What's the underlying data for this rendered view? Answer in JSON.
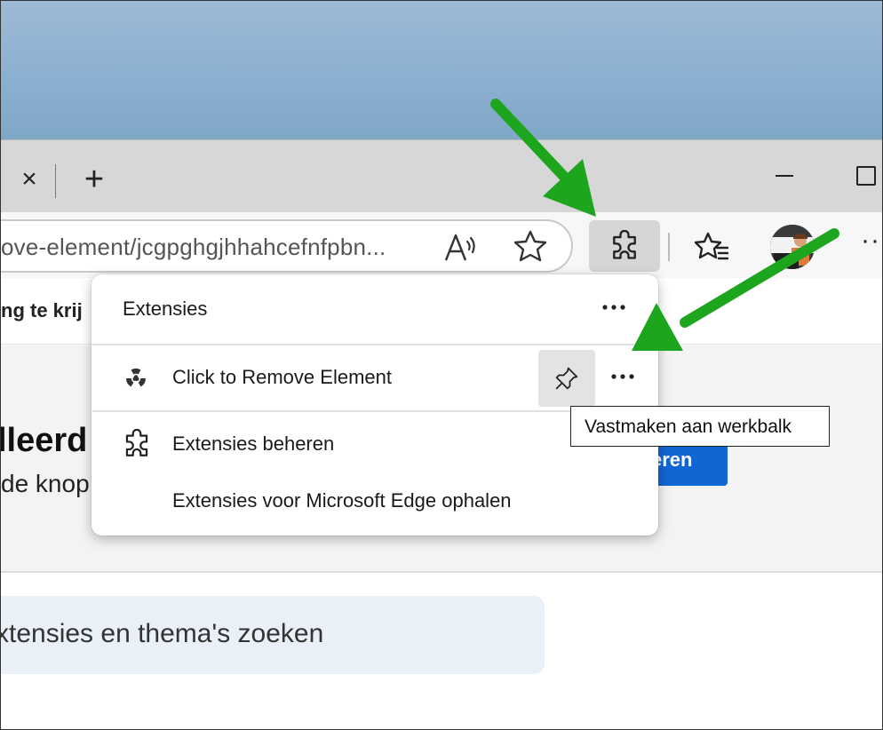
{
  "tabbar": {
    "close_glyph": "×",
    "new_tab_glyph": "+"
  },
  "toolbar": {
    "address_text": "ove-element/jcgpghgjhhahcefnfpbn...",
    "more_glyph": "···"
  },
  "page": {
    "bookmark_text": "ng te krij",
    "banner_heading": "lleerd",
    "banner_subtext": "de knop",
    "banner_button": "eren",
    "search_text": "xtensies en thema's zoeken"
  },
  "extensions_menu": {
    "title": "Extensies",
    "extension_name": "Click to Remove Element",
    "manage_label": "Extensies beheren",
    "get_label": "Extensies voor Microsoft Edge ophalen"
  },
  "tooltip": {
    "text": "Vastmaken aan werkbalk"
  },
  "colors": {
    "accent_blue": "#1166d4",
    "arrow_green": "#1ea51e"
  }
}
